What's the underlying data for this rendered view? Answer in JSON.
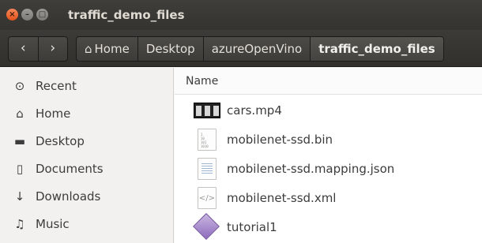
{
  "window": {
    "title": "traffic_demo_files",
    "buttons": {
      "close": "×",
      "minimize": "–",
      "maximize": "□"
    }
  },
  "toolbar": {
    "back_icon": "‹",
    "forward_icon": "›",
    "home_icon": "⌂",
    "breadcrumbs": [
      "Home",
      "Desktop",
      "azureOpenVino",
      "traffic_demo_files"
    ]
  },
  "sidebar": {
    "items": [
      {
        "label": "Recent",
        "icon": "clock-icon",
        "glyph": "⊙"
      },
      {
        "label": "Home",
        "icon": "home-icon",
        "glyph": "⌂"
      },
      {
        "label": "Desktop",
        "icon": "folder-icon",
        "glyph": "▬"
      },
      {
        "label": "Documents",
        "icon": "document-icon",
        "glyph": "▯"
      },
      {
        "label": "Downloads",
        "icon": "download-icon",
        "glyph": "↓"
      },
      {
        "label": "Music",
        "icon": "music-icon",
        "glyph": "♫"
      }
    ]
  },
  "list": {
    "column_header": "Name",
    "files": [
      {
        "name": "cars.mp4",
        "icon": "video-file-icon"
      },
      {
        "name": "mobilenet-ssd.bin",
        "icon": "binary-file-icon",
        "icon_text": "1\n10\n101\n1010"
      },
      {
        "name": "mobilenet-ssd.mapping.json",
        "icon": "text-file-icon"
      },
      {
        "name": "mobilenet-ssd.xml",
        "icon": "xml-file-icon",
        "icon_text": "</>"
      },
      {
        "name": "tutorial1",
        "icon": "executable-file-icon"
      }
    ]
  }
}
